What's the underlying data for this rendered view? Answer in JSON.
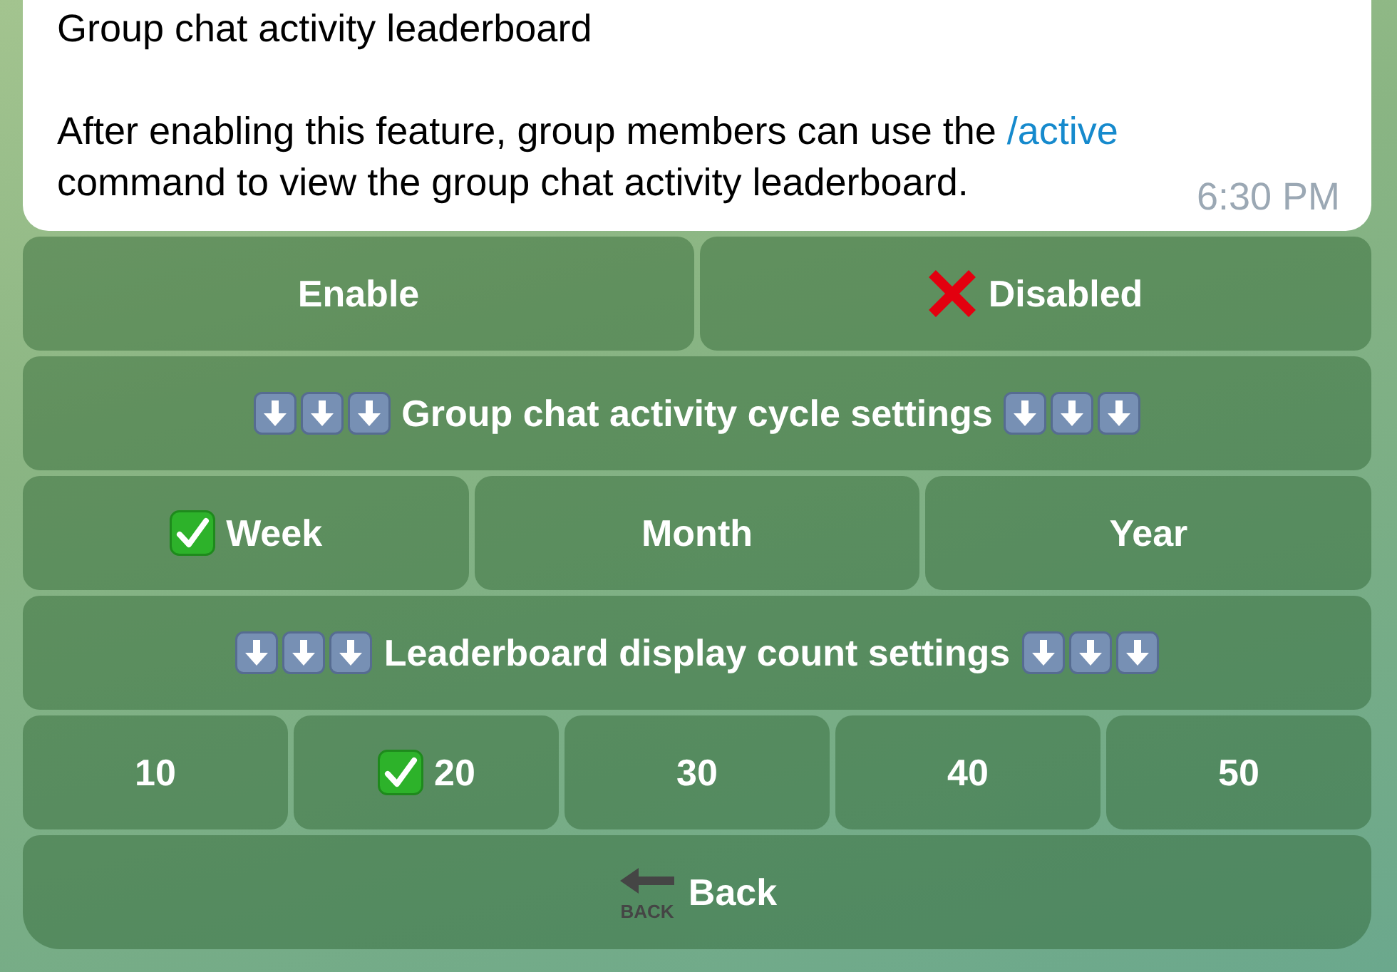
{
  "message": {
    "title": "Group chat activity leaderboard",
    "text_before": "After enabling this feature, group members can use the",
    "command": "/active",
    "text_after": "command to view the group chat activity leaderboard.",
    "time": "6:30 PM"
  },
  "keyboard": [
    {
      "kind": "toggle",
      "buttons": [
        {
          "label": "Enable",
          "selected": false
        },
        {
          "label": "Disabled",
          "selected": true
        }
      ]
    },
    {
      "kind": "header",
      "buttons": [
        {
          "label": "Group chat activity cycle settings"
        }
      ]
    },
    {
      "kind": "options",
      "buttons": [
        {
          "label": "Week",
          "selected": true
        },
        {
          "label": "Month",
          "selected": false
        },
        {
          "label": "Year",
          "selected": false
        }
      ]
    },
    {
      "kind": "header",
      "buttons": [
        {
          "label": "Leaderboard display count settings"
        }
      ]
    },
    {
      "kind": "options",
      "buttons": [
        {
          "label": "10",
          "selected": false
        },
        {
          "label": "20",
          "selected": true
        },
        {
          "label": "30",
          "selected": false
        },
        {
          "label": "40",
          "selected": false
        },
        {
          "label": "50",
          "selected": false
        }
      ]
    },
    {
      "kind": "back",
      "buttons": [
        {
          "label": "Back",
          "icon_caption": "BACK"
        }
      ]
    }
  ]
}
